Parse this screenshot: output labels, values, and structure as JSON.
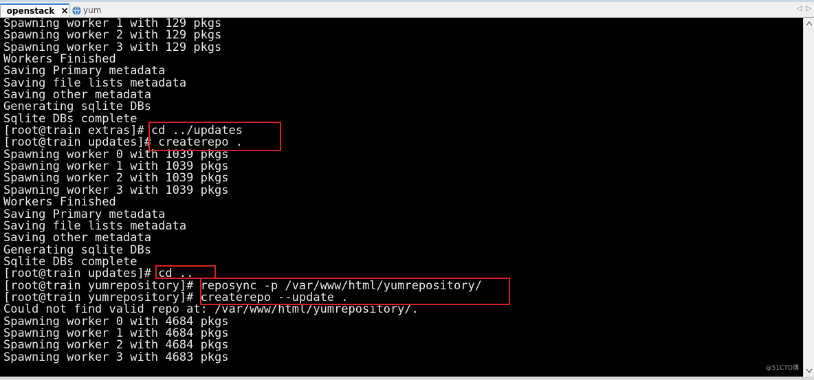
{
  "tabs": [
    {
      "label": "openstack",
      "active": true,
      "icon": "check-icon",
      "close": "×"
    },
    {
      "label": "yum",
      "active": false,
      "icon": "globe-icon"
    }
  ],
  "tab_nav": {
    "prev": "◁",
    "next": "▷"
  },
  "colors": {
    "terminal_bg": "#000000",
    "terminal_fg": "#e8e8e8",
    "highlight_border": "#e02020",
    "active_tab_accent": "#3c7fd1"
  },
  "terminal": {
    "lines": [
      "Spawning worker 1 with 129 pkgs",
      "Spawning worker 2 with 129 pkgs",
      "Spawning worker 3 with 129 pkgs",
      "Workers Finished",
      "Saving Primary metadata",
      "Saving file lists metadata",
      "Saving other metadata",
      "Generating sqlite DBs",
      "Sqlite DBs complete",
      "[root@train extras]# cd ../updates",
      "[root@train updates]# createrepo .",
      "Spawning worker 0 with 1039 pkgs",
      "Spawning worker 1 with 1039 pkgs",
      "Spawning worker 2 with 1039 pkgs",
      "Spawning worker 3 with 1039 pkgs",
      "Workers Finished",
      "Saving Primary metadata",
      "Saving file lists metadata",
      "Saving other metadata",
      "Generating sqlite DBs",
      "Sqlite DBs complete",
      "[root@train updates]# cd ..",
      "[root@train yumrepository]# reposync -p /var/www/html/yumrepository/",
      "[root@train yumrepository]# createrepo --update .",
      "Could not find valid repo at: /var/www/html/yumrepository/.",
      "Spawning worker 0 with 4684 pkgs",
      "Spawning worker 1 with 4684 pkgs",
      "Spawning worker 2 with 4684 pkgs",
      "Spawning worker 3 with 4683 pkgs"
    ]
  },
  "watermark": "@51CTO博"
}
